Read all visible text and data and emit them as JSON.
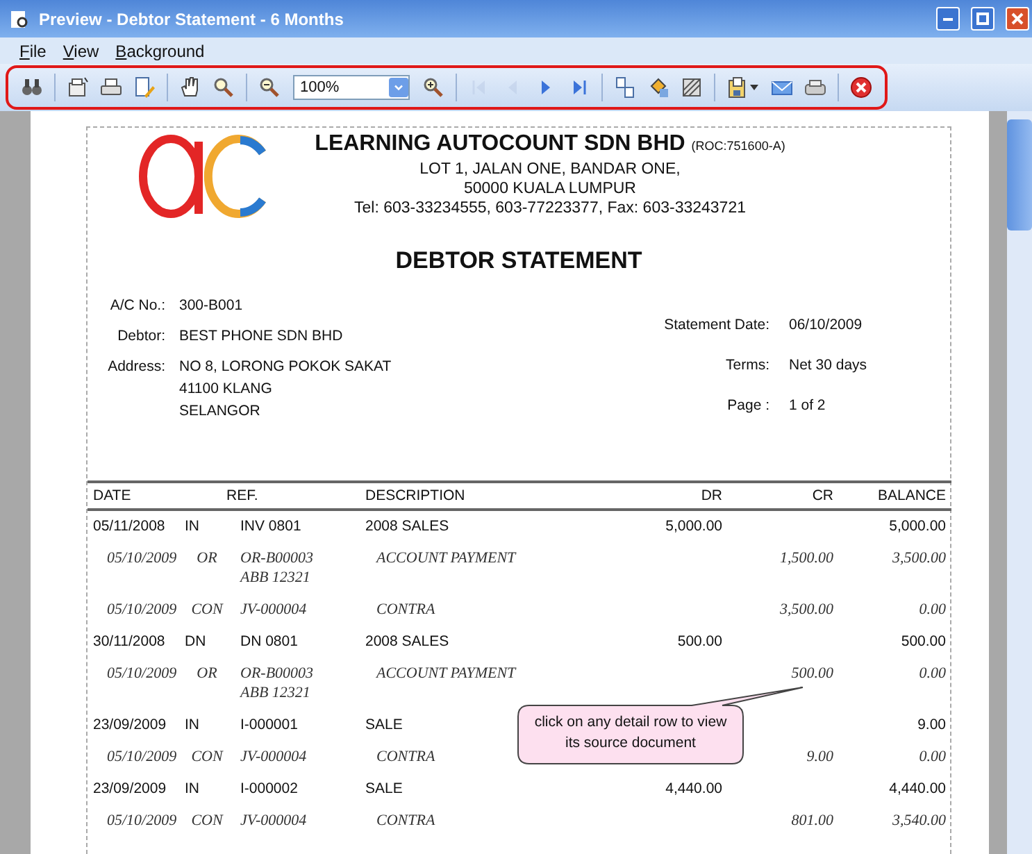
{
  "window": {
    "title": "Preview - Debtor Statement - 6 Months"
  },
  "menu": [
    {
      "label": "File"
    },
    {
      "label": "View"
    },
    {
      "label": "Background"
    }
  ],
  "toolbar": [
    {
      "kind": "button",
      "disabled": false
    },
    {
      "kind": "separator"
    },
    {
      "kind": "button",
      "disabled": false
    },
    {
      "kind": "button",
      "disabled": false
    },
    {
      "kind": "button",
      "disabled": false
    },
    {
      "kind": "separator"
    },
    {
      "kind": "button",
      "disabled": false
    },
    {
      "kind": "button",
      "disabled": false
    },
    {
      "kind": "separator"
    },
    {
      "kind": "button",
      "disabled": false
    },
    {
      "kind": "combo",
      "value": "100%"
    },
    {
      "kind": "button",
      "disabled": false
    },
    {
      "kind": "separator"
    },
    {
      "kind": "button",
      "disabled": true
    },
    {
      "kind": "button",
      "disabled": true
    },
    {
      "kind": "button",
      "disabled": false
    },
    {
      "kind": "button",
      "disabled": false
    },
    {
      "kind": "separator"
    },
    {
      "kind": "button",
      "disabled": false
    },
    {
      "kind": "button",
      "disabled": false
    },
    {
      "kind": "button",
      "disabled": false
    },
    {
      "kind": "separator"
    },
    {
      "kind": "dropdown",
      "disabled": false
    },
    {
      "kind": "button",
      "disabled": false
    },
    {
      "kind": "button",
      "disabled": false
    },
    {
      "kind": "separator"
    },
    {
      "kind": "button",
      "disabled": false
    }
  ],
  "company": {
    "name": "LEARNING AUTOCOUNT SDN BHD",
    "registration": "(ROC:751600-A)",
    "address_lines": [
      "LOT 1, JALAN ONE,  BANDAR ONE,",
      "50000  KUALA LUMPUR",
      "Tel: 603-33234555,  603-77223377,  Fax: 603-33243721"
    ]
  },
  "document_title": "DEBTOR STATEMENT",
  "customer": [
    {
      "label": "A/C No.:",
      "lines": [
        "300-B001"
      ]
    },
    {
      "label": "Debtor:",
      "lines": [
        "BEST PHONE SDN BHD"
      ]
    },
    {
      "label": "Address:",
      "lines": [
        "NO 8, LORONG POKOK SAKAT",
        "41100 KLANG",
        "SELANGOR"
      ]
    }
  ],
  "statement_info": [
    {
      "label": "Statement Date:",
      "value": "06/10/2009"
    },
    {
      "label": "Terms:",
      "value": "Net 30 days"
    },
    {
      "label": "Page :",
      "value": "1 of 2"
    }
  ],
  "table": {
    "columns": [
      "DATE",
      "REF.",
      "DESCRIPTION",
      "DR",
      "CR",
      "BALANCE"
    ],
    "rows": [
      {
        "kind": "main",
        "date": "05/11/2008",
        "type": "IN",
        "ref": [
          "INV 0801"
        ],
        "description": "2008 SALES",
        "dr": "5,000.00",
        "cr": "",
        "balance": "5,000.00"
      },
      {
        "kind": "detail",
        "date": "05/10/2009",
        "type": "OR",
        "ref": [
          "OR-B00003",
          "ABB 12321"
        ],
        "description": "ACCOUNT PAYMENT",
        "dr": "",
        "cr": "1,500.00",
        "balance": "3,500.00"
      },
      {
        "kind": "detail",
        "date": "05/10/2009",
        "type": "CON",
        "ref": [
          "JV-000004"
        ],
        "description": "CONTRA",
        "dr": "",
        "cr": "3,500.00",
        "balance": "0.00"
      },
      {
        "kind": "main",
        "date": "30/11/2008",
        "type": "DN",
        "ref": [
          "DN 0801"
        ],
        "description": "2008 SALES",
        "dr": "500.00",
        "cr": "",
        "balance": "500.00"
      },
      {
        "kind": "detail",
        "date": "05/10/2009",
        "type": "OR",
        "ref": [
          "OR-B00003",
          "ABB 12321"
        ],
        "description": "ACCOUNT PAYMENT",
        "dr": "",
        "cr": "500.00",
        "balance": "0.00"
      },
      {
        "kind": "main",
        "date": "23/09/2009",
        "type": "IN",
        "ref": [
          "I-000001"
        ],
        "description": "SALE",
        "dr": "",
        "cr": "",
        "balance": "9.00"
      },
      {
        "kind": "detail",
        "date": "05/10/2009",
        "type": "CON",
        "ref": [
          "JV-000004"
        ],
        "description": "CONTRA",
        "dr": "",
        "cr": "9.00",
        "balance": "0.00"
      },
      {
        "kind": "main",
        "date": "23/09/2009",
        "type": "IN",
        "ref": [
          "I-000002"
        ],
        "description": "SALE",
        "dr": "4,440.00",
        "cr": "",
        "balance": "4,440.00"
      },
      {
        "kind": "detail",
        "date": "05/10/2009",
        "type": "CON",
        "ref": [
          "JV-000004"
        ],
        "description": "CONTRA",
        "dr": "",
        "cr": "801.00",
        "balance": "3,540.00"
      }
    ]
  },
  "callout": {
    "text": "click on any detail row to view its source document"
  }
}
